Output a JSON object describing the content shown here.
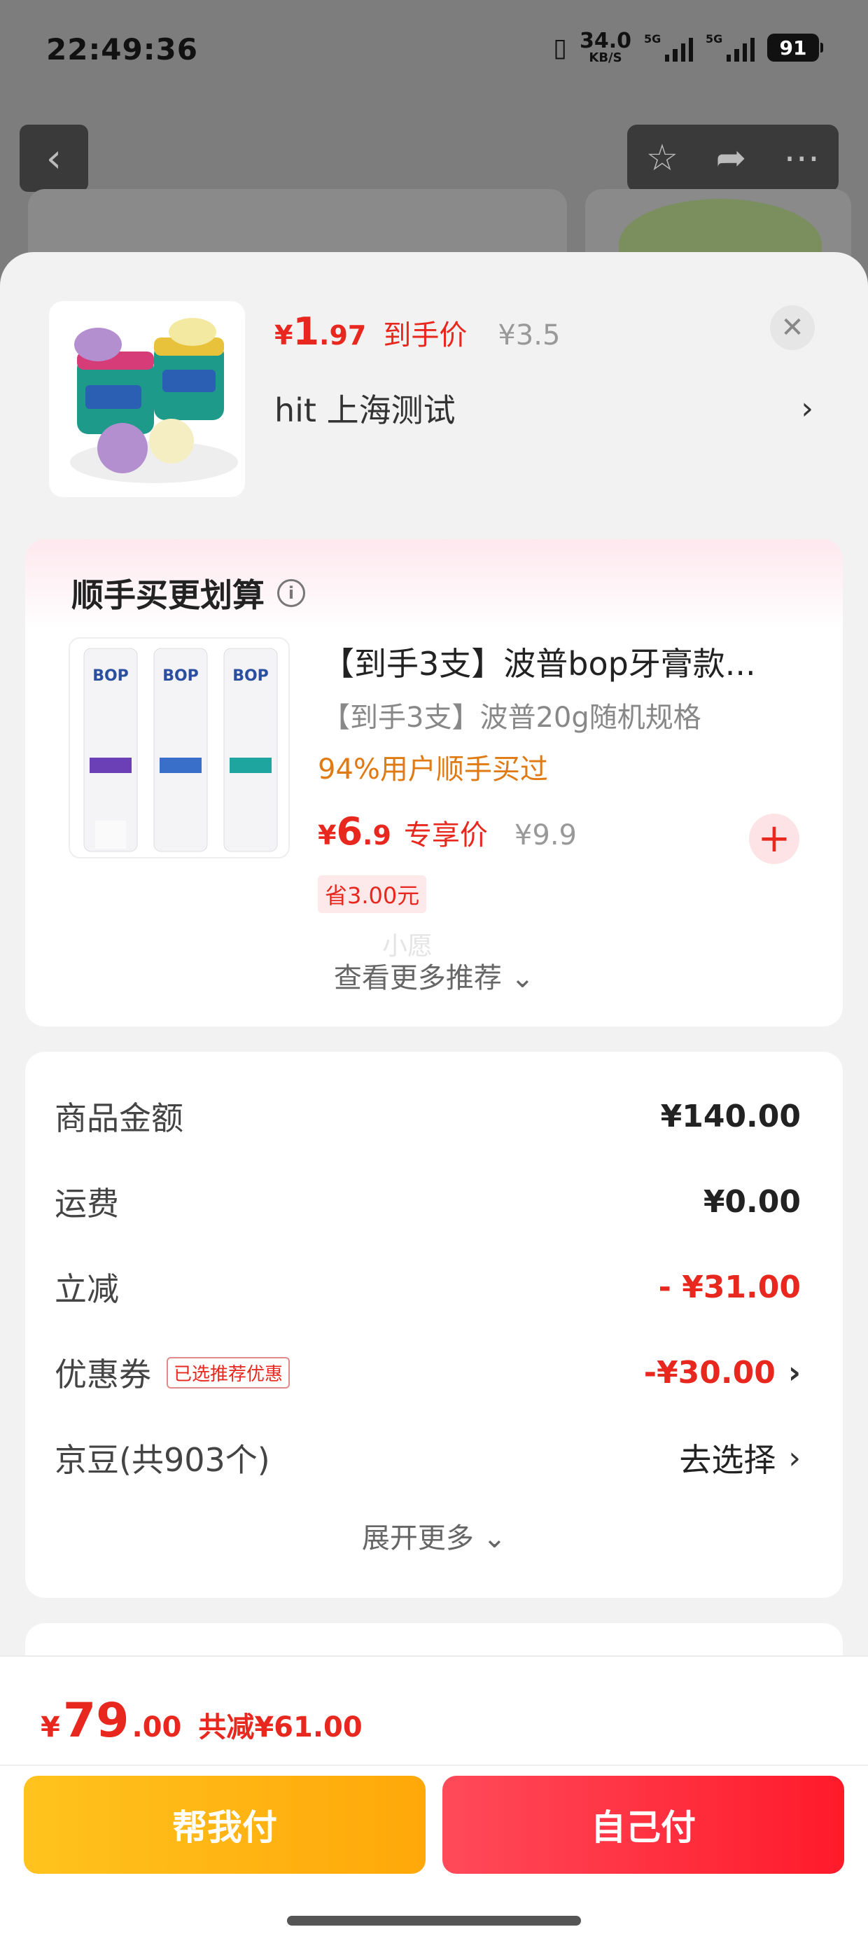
{
  "status_bar": {
    "time": "22:49:36",
    "net_speed": "34.0",
    "net_unit": "KB/S",
    "signal1_label": "5G",
    "signal2_label": "5G",
    "battery": "91"
  },
  "product": {
    "price_symbol": "¥",
    "price_int": "1",
    "price_dec": ".97",
    "price_label": "到手价",
    "original_price": "¥3.5",
    "store": "hit  上海测试"
  },
  "recommend": {
    "title": "顺手买更划算",
    "item_name": "【到手3支】波普bop牙膏款...",
    "item_sub": "【到手3支】波普20g随机规格",
    "hot_text": "94%用户顺手买过",
    "price_symbol": "¥",
    "price_int": "6",
    "price_dec": ".9",
    "price_label": "专享价",
    "original_price": "¥9.9",
    "save_tag": "省3.00元",
    "watermark": "小愿",
    "more": "查看更多推荐 ⌄"
  },
  "amounts": {
    "goods_label": "商品金额",
    "goods_value": "¥140.00",
    "shipping_label": "运费",
    "shipping_value": "¥0.00",
    "discount_label": "立减",
    "discount_value": "- ¥31.00",
    "coupon_label": "优惠券",
    "coupon_tag": "已选推荐优惠",
    "coupon_value": "-¥30.00",
    "jingdou_label": "京豆(共903个)",
    "jingdou_value": "去选择",
    "expand": "展开更多 ⌄"
  },
  "bottom": {
    "total_symbol": "¥",
    "total_int": "79",
    "total_dec": ".00",
    "total_discount": "共减¥61.00",
    "friend_pay": "帮我付",
    "self_pay": "自己付"
  },
  "colors": {
    "accent_red": "#e8281e",
    "hot_orange": "#e07a12",
    "friend_btn": "#ffb414",
    "self_btn": "#ff2a3a"
  }
}
